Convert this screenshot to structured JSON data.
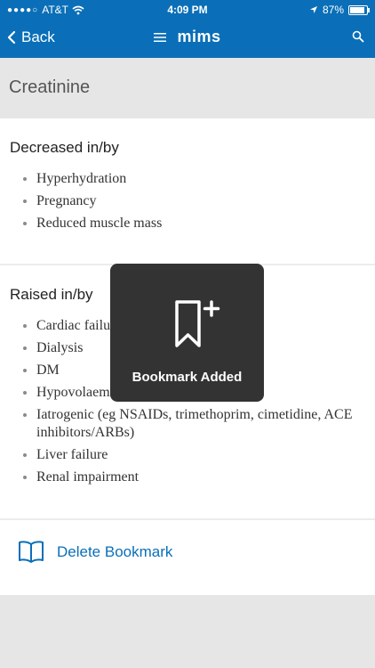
{
  "status_bar": {
    "carrier": "AT&T",
    "time": "4:09 PM",
    "battery": "87%",
    "battery_level": 0.87
  },
  "nav": {
    "back_label": "Back",
    "logo_text": "mims"
  },
  "page": {
    "title": "Creatinine"
  },
  "decreased": {
    "heading": "Decreased in/by",
    "items": [
      "Hyperhydration",
      "Pregnancy",
      "Reduced muscle mass"
    ]
  },
  "raised": {
    "heading": "Raised in/by",
    "items": [
      "Cardiac failure",
      "Dialysis",
      "DM",
      "Hypovolaemia",
      "Iatrogenic (eg NSAIDs, trimethoprim, cimetidine, ACE inhibitors/ARBs)",
      "Liver failure",
      "Renal impairment"
    ]
  },
  "bookmark": {
    "delete_label": "Delete Bookmark"
  },
  "toast": {
    "label": "Bookmark Added"
  },
  "colors": {
    "brand_blue": "#0a6fb8",
    "toast_bg": "#333333"
  }
}
